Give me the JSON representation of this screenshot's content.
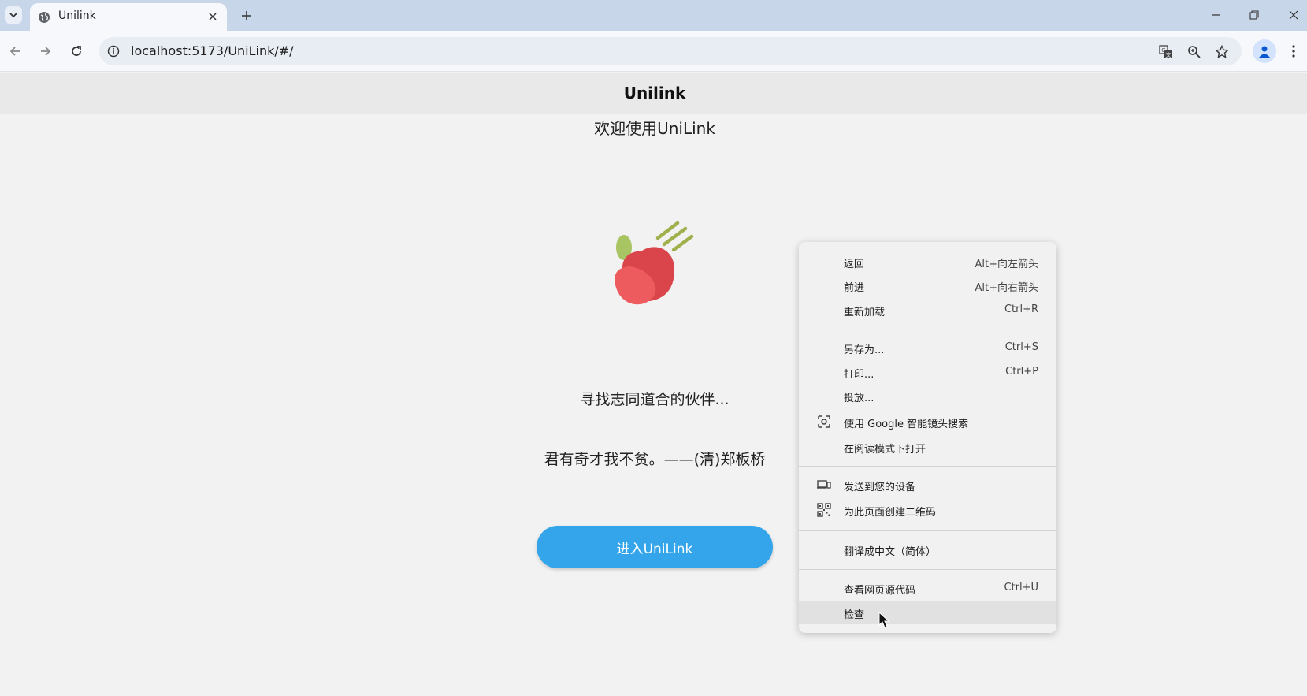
{
  "browser": {
    "tab": {
      "title": "Unilink"
    },
    "address_bar": {
      "url": "localhost:5173/UniLink/#/"
    }
  },
  "page": {
    "header_title": "Unilink",
    "welcome": "欢迎使用UniLink",
    "tagline": "寻找志同道合的伙伴...",
    "quote": "君有奇才我不贫。——(清)郑板桥",
    "enter_button": "进入UniLink"
  },
  "context_menu": {
    "items": [
      {
        "label": "返回",
        "shortcut": "Alt+向左箭头"
      },
      {
        "label": "前进",
        "shortcut": "Alt+向右箭头"
      },
      {
        "label": "重新加载",
        "shortcut": "Ctrl+R"
      },
      {
        "label": "另存为...",
        "shortcut": "Ctrl+S"
      },
      {
        "label": "打印...",
        "shortcut": "Ctrl+P"
      },
      {
        "label": "投放...",
        "shortcut": ""
      },
      {
        "label": "使用 Google 智能镜头搜索",
        "shortcut": "",
        "icon": "lens-icon"
      },
      {
        "label": "在阅读模式下打开",
        "shortcut": ""
      },
      {
        "label": "发送到您的设备",
        "shortcut": "",
        "icon": "devices-icon"
      },
      {
        "label": "为此页面创建二维码",
        "shortcut": "",
        "icon": "qr-code-icon"
      },
      {
        "label": "翻译成中文（简体）",
        "shortcut": ""
      },
      {
        "label": "查看网页源代码",
        "shortcut": "Ctrl+U"
      },
      {
        "label": "检查",
        "shortcut": ""
      }
    ]
  },
  "colors": {
    "tab_strip": "#c8d6ea",
    "primary_button": "#34a5ea",
    "apple_red": "#de4a4f",
    "leaf_green": "#9fbf5a"
  }
}
